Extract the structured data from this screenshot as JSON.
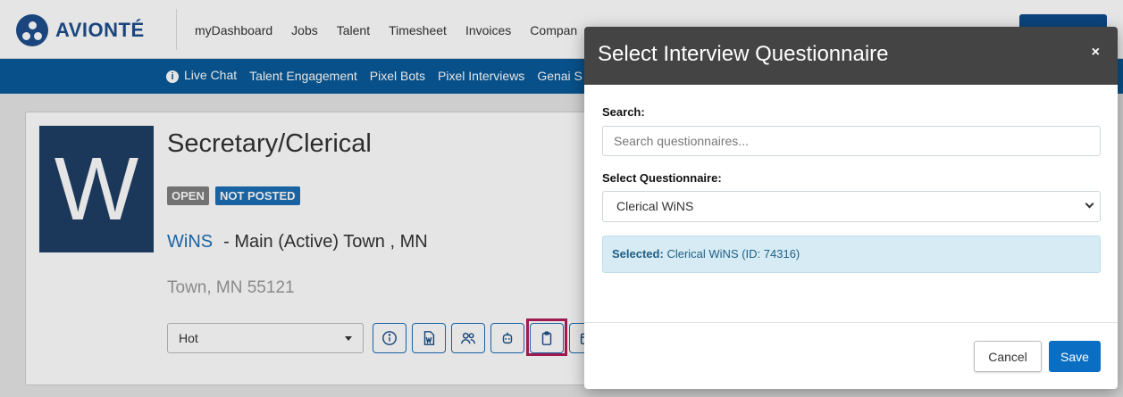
{
  "app": {
    "brand": "AVIONTÉ",
    "main_nav": [
      "myDashboard",
      "Jobs",
      "Talent",
      "Timesheet",
      "Invoices",
      "Compan"
    ],
    "sub_nav": [
      "Live Chat",
      "Talent Engagement",
      "Pixel Bots",
      "Pixel Interviews",
      "Genai S"
    ]
  },
  "job": {
    "avatar_letter": "W",
    "title": "Secretary/Clerical",
    "badge_open": "OPEN",
    "badge_not_posted": "NOT POSTED",
    "company": "WiNS",
    "location_line": "- Main (Active) Town , MN",
    "address": "Town, MN 55121",
    "priority": "Hot"
  },
  "modal": {
    "title": "Select Interview Questionnaire",
    "close": "×",
    "search_label": "Search:",
    "search_placeholder": "Search questionnaires...",
    "select_label": "Select Questionnaire:",
    "selected_option": "Clerical WiNS",
    "alert_label": "Selected:",
    "alert_text": "Clerical WiNS (ID: 74316)",
    "cancel_label": "Cancel",
    "save_label": "Save"
  },
  "colors": {
    "brand_blue": "#1f4e8c",
    "subbar": "#0a5a99",
    "modal_header": "#444444",
    "save": "#0a6ec2",
    "highlight": "#b01e5a"
  }
}
